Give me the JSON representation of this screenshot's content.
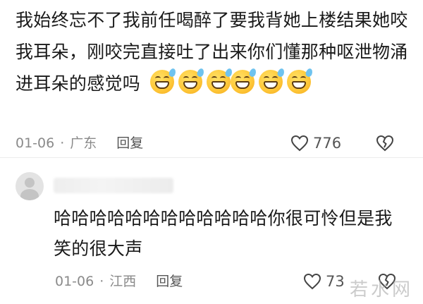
{
  "comment": {
    "text": "我始终忘不了我前任喝醉了要我背她上楼结果她咬我耳朵，刚咬完直接吐了出来你们懂那种呕泄物涌进耳朵的感觉吗",
    "emoji_count": 6,
    "emoji_name": "grinning-sweat-emoji",
    "date": "01-06",
    "location": "广东",
    "reply_label": "回复",
    "like_count": "776"
  },
  "reply": {
    "text": "哈哈哈哈哈哈哈哈哈哈哈哈你很可怜但是我笑的很大声",
    "date": "01-06",
    "location": "江西",
    "reply_label": "回复",
    "like_count": "73"
  },
  "meta_separator": "·",
  "watermark": "若水网",
  "colors": {
    "meta_text": "#8a8a8a",
    "body_text": "#1a1a1a",
    "emoji_yellow": "#ffc93a"
  }
}
